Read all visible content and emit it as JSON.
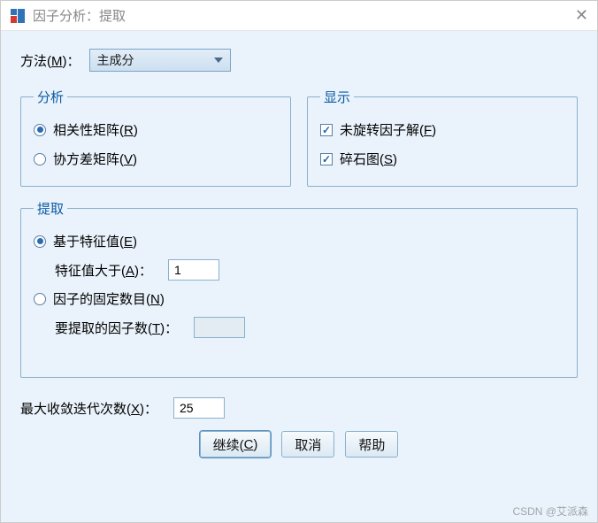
{
  "titlebar": {
    "title": "因子分析：提取",
    "close_glyph": "✕"
  },
  "method": {
    "label_prefix": "方法(",
    "label_hotkey": "M",
    "label_suffix": ")：",
    "selected": "主成分"
  },
  "analysis": {
    "legend": "分析",
    "correlation_label": "相关性矩阵(",
    "correlation_hotkey": "R",
    "correlation_suffix": ")",
    "covariance_label": "协方差矩阵(",
    "covariance_hotkey": "V",
    "covariance_suffix": ")",
    "selected": "correlation"
  },
  "display": {
    "legend": "显示",
    "unrotated_label": "未旋转因子解(",
    "unrotated_hotkey": "F",
    "unrotated_suffix": ")",
    "scree_label": "碎石图(",
    "scree_hotkey": "S",
    "scree_suffix": ")",
    "unrotated_checked": true,
    "scree_checked": true
  },
  "extract": {
    "legend": "提取",
    "eigen_label": "基于特征值(",
    "eigen_hotkey": "E",
    "eigen_suffix": ")",
    "eigen_gt_label": "特征值大于(",
    "eigen_gt_hotkey": "A",
    "eigen_gt_suffix": ")：",
    "eigen_gt_value": "1",
    "fixed_label": "因子的固定数目(",
    "fixed_hotkey": "N",
    "fixed_suffix": ")",
    "fixed_n_label": "要提取的因子数(",
    "fixed_n_hotkey": "T",
    "fixed_n_suffix": ")：",
    "fixed_n_value": "",
    "selected": "eigen"
  },
  "maxiter": {
    "label_prefix": "最大收敛迭代次数(",
    "label_hotkey": "X",
    "label_suffix": ")：",
    "value": "25"
  },
  "buttons": {
    "continue_prefix": "继续(",
    "continue_hotkey": "C",
    "continue_suffix": ")",
    "cancel": "取消",
    "help": "帮助"
  },
  "watermark": "CSDN @艾派森"
}
